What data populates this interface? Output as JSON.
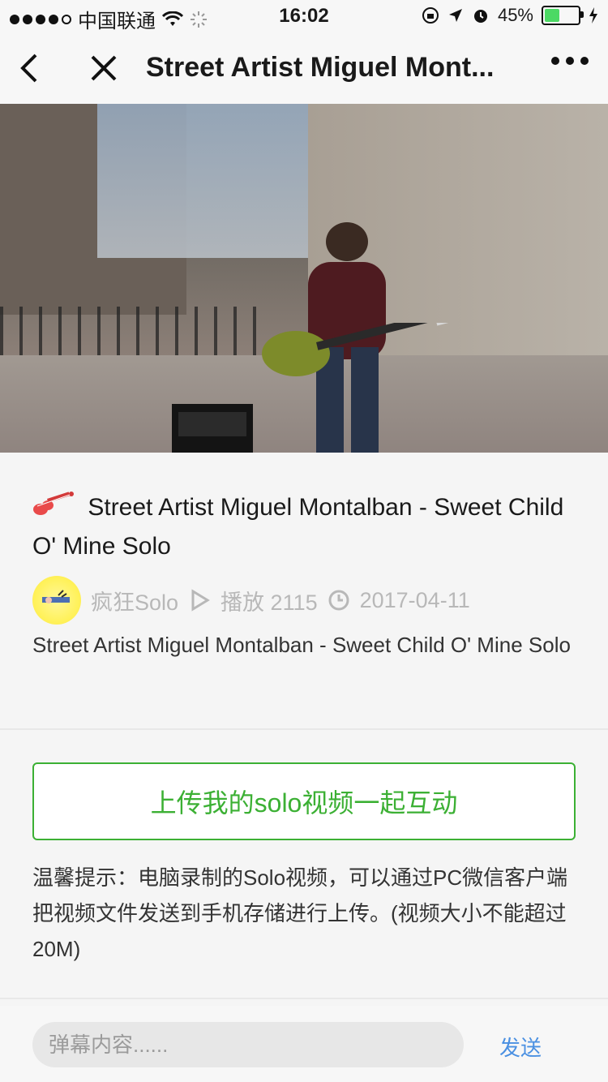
{
  "status_bar": {
    "carrier": "中国联通",
    "time": "16:02",
    "battery": "45%",
    "battery_level": 0.45
  },
  "nav": {
    "title": "Street Artist Miguel Mont..."
  },
  "video": {
    "thumbnail": "street-guitarist-scene"
  },
  "post": {
    "title": "Street Artist Miguel Montalban - Sweet Child O' Mine Solo",
    "author": "疯狂Solo",
    "plays_label": "播放 2115",
    "date": "2017-04-11",
    "description": " Street Artist Miguel Montalban - Sweet Child O' Mine Solo"
  },
  "actions": {
    "upload_label": "上传我的solo视频一起互动"
  },
  "tip": {
    "text": " 温馨提示：电脑录制的Solo视频，可以通过PC微信客户端把视频文件发送到手机存储进行上传。(视频大小不能超过20M)"
  },
  "bottom": {
    "danmu_placeholder": "弹幕内容......",
    "send_label": "发送"
  },
  "colors": {
    "accent_green": "#3cb034",
    "link_blue": "#4a90e2",
    "muted_gray": "#b8b8b8"
  },
  "icons": {
    "back": "chevron-left-icon",
    "close": "close-icon",
    "more": "more-icon",
    "guitar": "guitar-icon",
    "play": "play-icon",
    "clock": "clock-icon"
  }
}
